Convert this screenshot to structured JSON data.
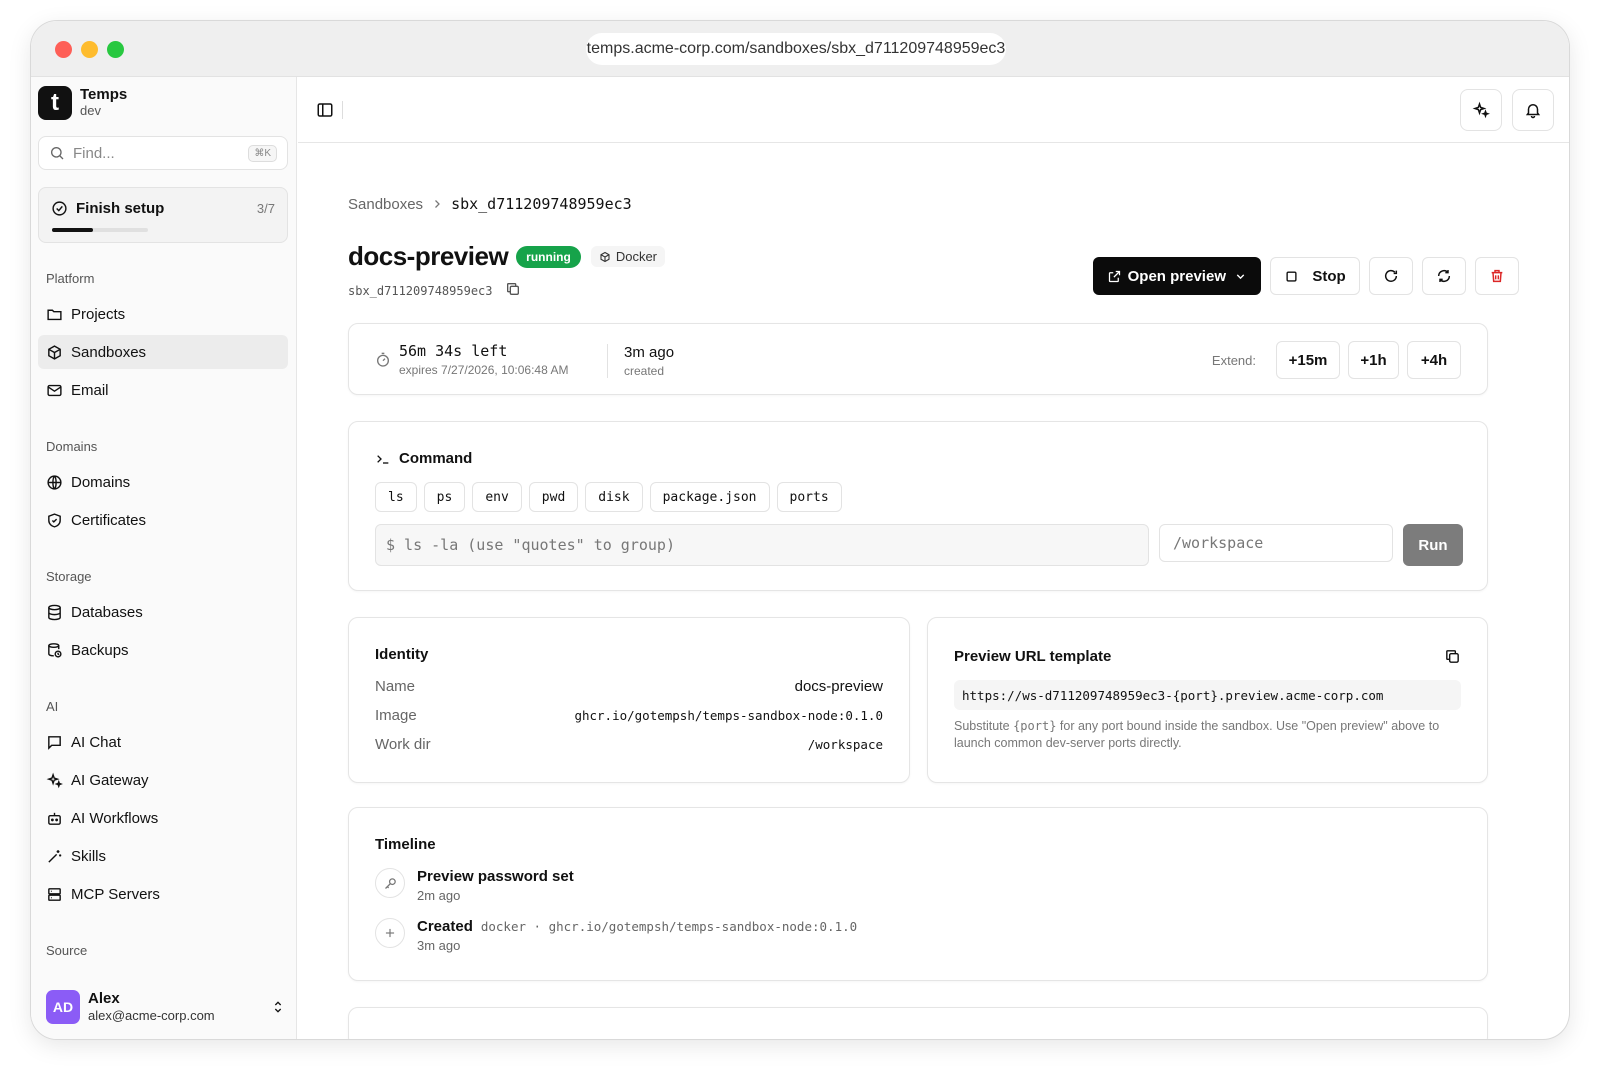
{
  "browser": {
    "url": "temps.acme-corp.com/sandboxes/sbx_d711209748959ec3"
  },
  "sidebar": {
    "brand": {
      "logo": "t",
      "name": "Temps",
      "env": "dev"
    },
    "search": {
      "placeholder": "Find...",
      "shortcut": "⌘K"
    },
    "setup": {
      "label": "Finish setup",
      "count": "3/7",
      "progress": 0.4286
    },
    "sections": [
      {
        "title": "Platform",
        "items": [
          {
            "label": "Projects",
            "icon": "folder-icon"
          },
          {
            "label": "Sandboxes",
            "icon": "box-icon",
            "active": true
          },
          {
            "label": "Email",
            "icon": "mail-icon"
          }
        ]
      },
      {
        "title": "Domains",
        "items": [
          {
            "label": "Domains",
            "icon": "globe-icon"
          },
          {
            "label": "Certificates",
            "icon": "shield-icon"
          }
        ]
      },
      {
        "title": "Storage",
        "items": [
          {
            "label": "Databases",
            "icon": "database-icon"
          },
          {
            "label": "Backups",
            "icon": "backup-icon"
          }
        ]
      },
      {
        "title": "AI",
        "items": [
          {
            "label": "AI Chat",
            "icon": "chat-icon"
          },
          {
            "label": "AI Gateway",
            "icon": "sparkles-icon"
          },
          {
            "label": "AI Workflows",
            "icon": "bot-icon"
          },
          {
            "label": "Skills",
            "icon": "wand-icon"
          },
          {
            "label": "MCP Servers",
            "icon": "server-icon"
          }
        ]
      },
      {
        "title": "Source",
        "items": []
      }
    ],
    "user": {
      "initials": "AD",
      "name": "Alex",
      "email": "alex@acme-corp.com"
    }
  },
  "breadcrumb": {
    "parent": "Sandboxes",
    "current": "sbx_d711209748959ec3"
  },
  "sandbox": {
    "name": "docs-preview",
    "status": "running",
    "runtime": "Docker",
    "id": "sbx_d711209748959ec3"
  },
  "actions": {
    "open_preview": "Open preview",
    "stop": "Stop"
  },
  "timer": {
    "left": "56m 34s left",
    "expires": "expires 7/27/2026, 10:06:48 AM",
    "created": "3m ago",
    "created_label": "created",
    "extend_label": "Extend:",
    "extend_options": [
      "+15m",
      "+1h",
      "+4h"
    ]
  },
  "command": {
    "title": "Command",
    "chips": [
      "ls",
      "ps",
      "env",
      "pwd",
      "disk",
      "package.json",
      "ports"
    ],
    "placeholder": "$ ls -la  (use \"quotes\" to group)",
    "workdir_placeholder": "/workspace",
    "run_label": "Run"
  },
  "identity": {
    "title": "Identity",
    "rows": [
      {
        "key": "Name",
        "value": "docs-preview"
      },
      {
        "key": "Image",
        "value": "ghcr.io/gotempsh/temps-sandbox-node:0.1.0"
      },
      {
        "key": "Work dir",
        "value": "/workspace"
      }
    ]
  },
  "preview_url": {
    "title": "Preview URL template",
    "template": "https://ws-d711209748959ec3-{port}.preview.acme-corp.com",
    "help_pre": "Substitute ",
    "help_code": "{port}",
    "help_post": " for any port bound inside the sandbox. Use \"Open preview\" above to launch common dev-server ports directly."
  },
  "timeline": {
    "title": "Timeline",
    "events": [
      {
        "title": "Preview password set",
        "meta": "",
        "time": "2m ago",
        "icon": "key-icon"
      },
      {
        "title": "Created",
        "meta": "docker · ghcr.io/gotempsh/temps-sandbox-node:0.1.0",
        "time": "3m ago",
        "icon": "plus-icon"
      }
    ]
  }
}
